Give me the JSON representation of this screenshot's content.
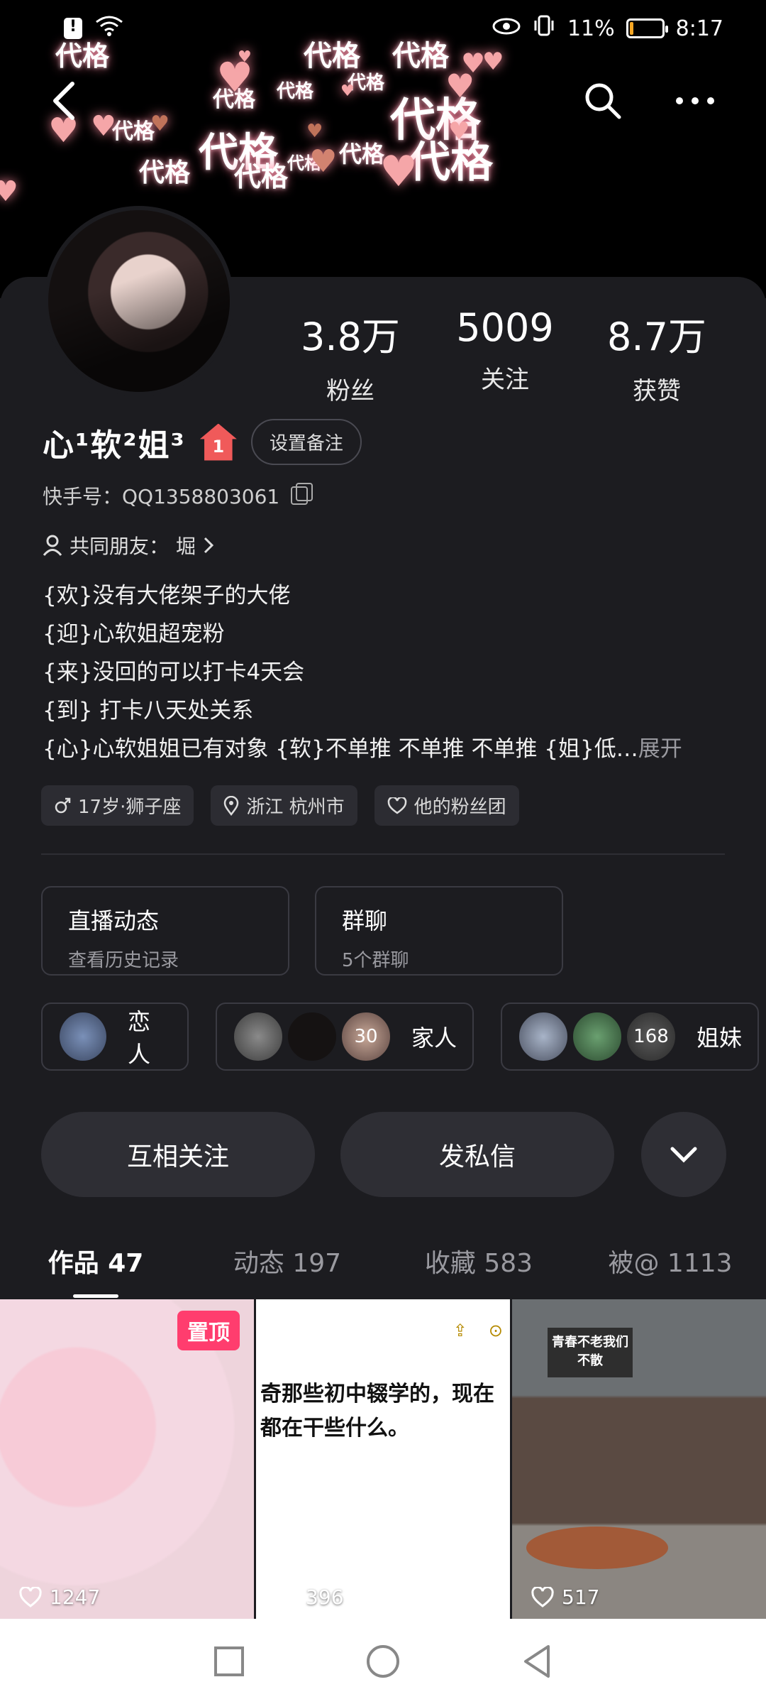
{
  "status_bar": {
    "battery": "11%",
    "battery_fill": 0.11,
    "time": "8:17"
  },
  "banner": {
    "sticker_text": "代格"
  },
  "stats": [
    {
      "value": "3.8万",
      "label": "粉丝"
    },
    {
      "value": "5009",
      "label": "关注"
    },
    {
      "value": "8.7万",
      "label": "获赞"
    }
  ],
  "profile": {
    "name": "心¹软²姐³",
    "home_badge": "1",
    "remark_button": "设置备注",
    "kuaishou_id": "快手号：QQ1358803061",
    "mutual_friends": "共同朋友：",
    "mutual_friend_name": "堀",
    "bio": [
      "{欢}没有大佬架子的大佬",
      "{迎}心软姐超宠粉",
      "{来}没回的可以打卡4天会",
      "{到} 打卡八天处关系",
      "{心}心软姐姐已有对象 {软}不单推 不单推 不单推 {姐}低…"
    ],
    "bio_more": "展开",
    "tags": [
      "17岁·狮子座",
      "浙江 杭州市",
      "他的粉丝团"
    ]
  },
  "entries": [
    {
      "title": "直播动态",
      "subtitle": "查看历史记录"
    },
    {
      "title": "群聊",
      "subtitle": "5个群聊"
    }
  ],
  "relations": [
    {
      "label": "恋人",
      "badge": ""
    },
    {
      "label": "家人",
      "badge": "30"
    },
    {
      "label": "姐妹",
      "badge": "168"
    }
  ],
  "actions": {
    "follow": "互相关注",
    "message": "发私信"
  },
  "tabs": [
    "作品 47",
    "动态 197",
    "收藏 583",
    "被@ 1113"
  ],
  "posts": [
    {
      "likes": "1247",
      "badge": "置顶"
    },
    {
      "likes": "396",
      "text": "奇那些初中辍学的，现在都在干些什么。"
    },
    {
      "likes": "517",
      "sign": "青春不老我们不散"
    }
  ]
}
